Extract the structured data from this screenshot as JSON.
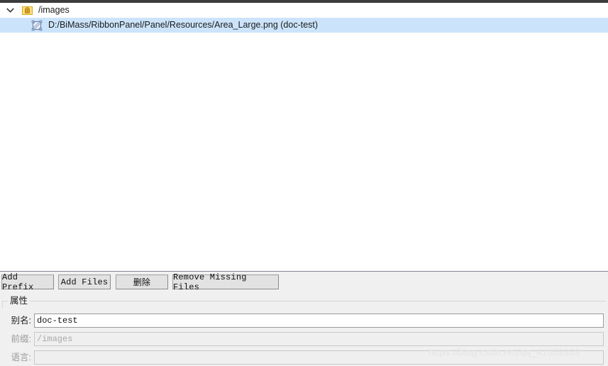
{
  "tree": {
    "root": {
      "label": "/images",
      "icon": "resource-prefix-icon",
      "expanded_icon": "chevron-down-icon"
    },
    "child": {
      "label": "D:/BiMass/RibbonPanel/Panel/Resources/Area_Large.png (doc-test)",
      "icon": "broken-image-icon",
      "selected": true
    }
  },
  "toolbar": {
    "add_prefix_label": "Add Prefix",
    "add_files_label": "Add Files",
    "delete_label": "删除",
    "remove_missing_label": "Remove Missing Files"
  },
  "properties": {
    "group_title": "属性",
    "alias": {
      "label": "别名:",
      "value": "doc-test"
    },
    "prefix": {
      "label": "前缀:",
      "value": "/images"
    },
    "language": {
      "label": "语言:",
      "value": ""
    }
  },
  "watermark": {
    "text": "https://blog.csdn.net/qq_41059339"
  },
  "colors": {
    "selection": "#cce4fb",
    "prefix_icon": "#f5cc55",
    "image_icon": "#6e87b0",
    "top_strip": "#3c3c3c"
  }
}
